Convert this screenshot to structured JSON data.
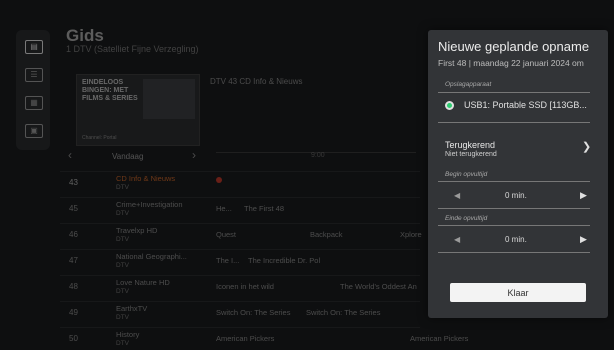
{
  "guide": {
    "title": "Gids",
    "subtitle": "1 DTV (Satelliet Fijne Verzegling)",
    "now_info": "DTV 43 CD Info & Nieuws",
    "date_label": "Vandaag",
    "banner": {
      "title": "EINDELOOS BINGEN: MET FILMS & SERIES",
      "footer": "Channel: Portal"
    },
    "time_ticks": [
      "",
      "9:00",
      ""
    ]
  },
  "channels": [
    {
      "num": "43",
      "name": "CD Info & Nieuws",
      "sub": "DTV",
      "highlight": true,
      "programs": []
    },
    {
      "num": "45",
      "name": "Crime+Investigation",
      "sub": "DTV",
      "programs": [
        {
          "title": "He..."
        },
        {
          "title": "The First 48"
        }
      ]
    },
    {
      "num": "46",
      "name": "Travelxp HD",
      "sub": "DTV",
      "programs": [
        {
          "title": "Quest"
        },
        {
          "title": "Backpack"
        },
        {
          "title": "Xplore"
        }
      ]
    },
    {
      "num": "47",
      "name": "National Geographi...",
      "sub": "DTV",
      "programs": [
        {
          "title": "The I..."
        },
        {
          "title": "The Incredible Dr. Pol"
        }
      ]
    },
    {
      "num": "48",
      "name": "Love Nature HD",
      "sub": "DTV",
      "programs": [
        {
          "title": "Iconen in het wild"
        },
        {
          "title": "The World's Oddest An"
        }
      ]
    },
    {
      "num": "49",
      "name": "EarthxTV",
      "sub": "DTV",
      "programs": [
        {
          "title": "Switch On: The Series"
        },
        {
          "title": "Switch On: The Series"
        }
      ]
    },
    {
      "num": "50",
      "name": "History",
      "sub": "DTV",
      "programs": [
        {
          "title": "American Pickers"
        },
        {
          "title": "American Pickers"
        }
      ]
    }
  ],
  "panel": {
    "title": "Nieuwe geplande opname",
    "subtitle": "First 48 | maandag 22 januari 2024 om",
    "storage_label": "Opslagapparaat",
    "storage_device": "USB1: Portable SSD [113GB...",
    "repeat_title": "Terugkerend",
    "repeat_value": "Niet terugkerend",
    "start_label": "Begin opvultijd",
    "start_value": "0 min.",
    "end_label": "Einde opvultijd",
    "end_value": "0 min.",
    "done_button": "Klaar"
  },
  "icons": {
    "rail": [
      "guide-icon",
      "list-icon",
      "schedule-icon",
      "recordings-icon"
    ],
    "left_arrow": "◀",
    "right_arrow": "▶",
    "chevron": "❯"
  },
  "colors": {
    "accent_green": "#2ecc71",
    "highlight_orange": "#c8652a",
    "live_red": "#c0392b"
  }
}
